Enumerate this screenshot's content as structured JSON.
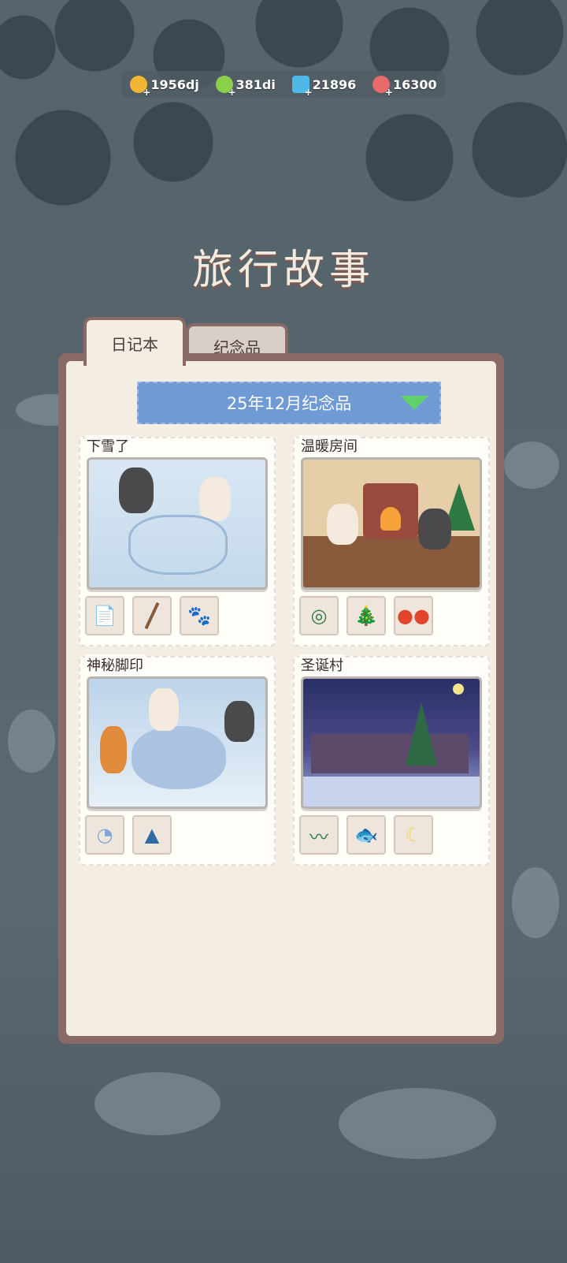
{
  "resources": [
    {
      "name": "coin-icon",
      "value": "1956dj",
      "color": "#f2b637"
    },
    {
      "name": "energy-icon",
      "value": "381di",
      "color": "#8bd04a"
    },
    {
      "name": "gem-icon",
      "value": "21896",
      "color": "#4fb8e8"
    },
    {
      "name": "candy-icon",
      "value": "16300",
      "color": "#e86a6a"
    }
  ],
  "title": "旅行故事",
  "tabs": {
    "diary": "日记本",
    "souvenir": "纪念品"
  },
  "month_selector": {
    "label": "25年12月纪念品"
  },
  "stories": [
    {
      "title": "下雪了",
      "items": [
        "paper-icon",
        "stick-icon",
        "paw-print-icon"
      ]
    },
    {
      "title": "温暖房间",
      "items": [
        "wreath-icon",
        "christmas-tree-icon",
        "tomatoes-icon"
      ]
    },
    {
      "title": "神秘脚印",
      "items": [
        "footprint-icon",
        "pine-trees-icon"
      ]
    },
    {
      "title": "圣诞村",
      "items": [
        "garland-icon",
        "fish-icon",
        "moon-icon"
      ]
    }
  ]
}
